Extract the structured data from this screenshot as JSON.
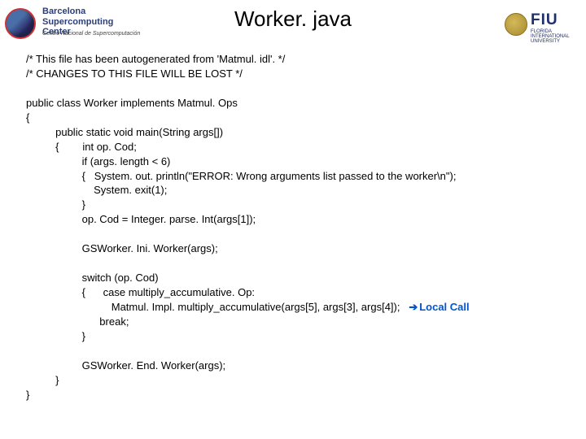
{
  "header": {
    "title": "Worker. java",
    "logo_left": {
      "line1": "Barcelona",
      "line2": "Supercomputing",
      "line3": "Center",
      "sub": "Centro Nacional de Supercomputación"
    },
    "logo_right": {
      "name": "FIU",
      "sub": "FLORIDA INTERNATIONAL UNIVERSITY"
    }
  },
  "code": {
    "l1": "/* This file has been autogenerated from 'Matmul. idl'. */",
    "l2": "/* CHANGES TO THIS FILE WILL BE LOST */",
    "l3": "",
    "l4": "public class Worker implements Matmul. Ops",
    "l5": "{",
    "l6": "          public static void main(String args[])",
    "l7": "          {        int op. Cod;",
    "l8": "                   if (args. length < 6)",
    "l9": "                   {   System. out. println(\"ERROR: Wrong arguments list passed to the worker\\n\");",
    "l10": "                       System. exit(1);",
    "l11": "                   }",
    "l12": "                   op. Cod = Integer. parse. Int(args[1]);",
    "l13": "",
    "l14": "                   GSWorker. Ini. Worker(args);",
    "l15": "",
    "l16": "                   switch (op. Cod)",
    "l17": "                   {      case multiply_accumulative. Op:",
    "l18": "                             Matmul. Impl. multiply_accumulative(args[5], args[3], args[4]);   ",
    "l19": "                         break;",
    "l20": "                   }",
    "l21": "",
    "l22": "                   GSWorker. End. Worker(args);",
    "l23": "          }",
    "l24": "}"
  },
  "annotation": {
    "arrow": "➔",
    "text": "Local Call"
  }
}
